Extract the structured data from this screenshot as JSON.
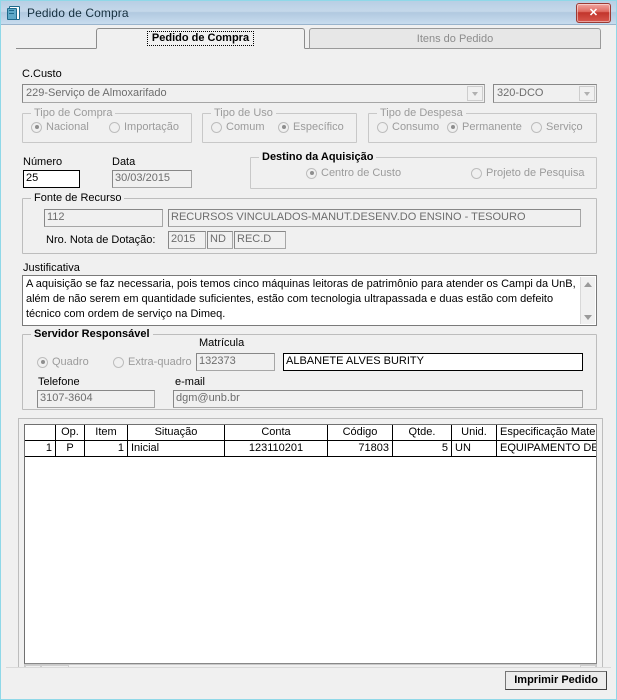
{
  "window": {
    "title": "Pedido de Compra",
    "icon": "form-icon",
    "close_label": "✕",
    "border_color": "#8fd8e8"
  },
  "tabs": [
    {
      "label": "Pedido de Compra",
      "active": true
    },
    {
      "label": "Itens do Pedido",
      "active": false
    }
  ],
  "form": {
    "ccusto": {
      "label": "C.Custo",
      "value": "229-Serviço de Almoxarifado",
      "unit_value": "320-DCO"
    },
    "tipo_compra": {
      "title": "Tipo de Compra",
      "options": [
        {
          "label": "Nacional",
          "selected": true
        },
        {
          "label": "Importação",
          "selected": false
        }
      ]
    },
    "tipo_uso": {
      "title": "Tipo de Uso",
      "options": [
        {
          "label": "Comum",
          "selected": false
        },
        {
          "label": "Específico",
          "selected": true
        }
      ]
    },
    "tipo_despesa": {
      "title": "Tipo de Despesa",
      "options": [
        {
          "label": "Consumo",
          "selected": false
        },
        {
          "label": "Permanente",
          "selected": true
        },
        {
          "label": "Serviço",
          "selected": false
        }
      ]
    },
    "numero": {
      "label": "Número",
      "value": "25"
    },
    "data": {
      "label": "Data",
      "value": "30/03/2015"
    },
    "destino": {
      "title": "Destino da Aquisição",
      "options": [
        {
          "label": "Centro de Custo",
          "selected": true
        },
        {
          "label": "Projeto de Pesquisa",
          "selected": false
        }
      ]
    },
    "fonte_recurso": {
      "title": "Fonte de Recurso",
      "code": "112",
      "description": "RECURSOS VINCULADOS-MANUT.DESENV.DO ENSINO - TESOURO",
      "nota_label": "Nro. Nota de Dotação:",
      "nota_ano": "2015",
      "nota_nd": "ND",
      "nota_rec": "REC.D"
    },
    "justificativa": {
      "label": "Justificativa",
      "text": "A aquisição se faz necessaria, pois temos cinco máquinas leitoras de patrimônio para atender os Campi da UnB, além de não serem em quantidade suficientes, estão com tecnologia ultrapassada e duas estão com defeito técnico com ordem de serviço na Dimeq."
    },
    "servidor": {
      "title": "Servidor Responsável",
      "options": [
        {
          "label": "Quadro",
          "selected": true
        },
        {
          "label": "Extra-quadro",
          "selected": false
        }
      ],
      "matricula_label": "Matrícula",
      "matricula": "132373",
      "nome": "ALBANETE ALVES BURITY",
      "telefone_label": "Telefone",
      "telefone": "3107-3604",
      "email_label": "e-mail",
      "email": "dgm@unb.br"
    }
  },
  "grid": {
    "columns": [
      "",
      "Op.",
      "Item",
      "Situação",
      "Conta",
      "Código",
      "Qtde.",
      "Unid.",
      "Especificação Material"
    ],
    "rows": [
      {
        "rownum": "1",
        "op": "P",
        "item": "1",
        "situacao": "Inicial",
        "conta": "123110201",
        "codigo": "71803",
        "qtde": "5",
        "unid": "UN",
        "especificacao": "EQUIPAMENTO DE COLETA DE DADO"
      }
    ]
  },
  "footer": {
    "print_label": "Imprimir Pedido"
  }
}
